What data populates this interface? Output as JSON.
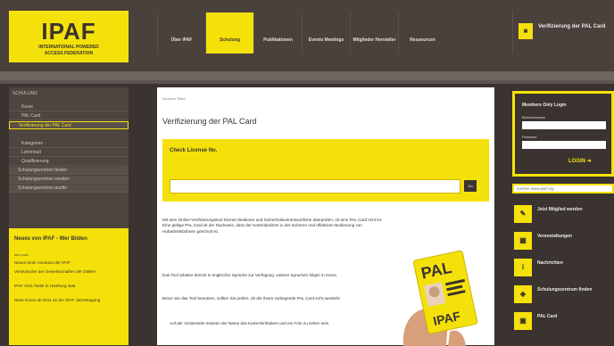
{
  "logo": {
    "name": "IPAF",
    "subtitle_1": "INTERNATIONAL POWERED",
    "subtitle_2": "ACCESS FEDERATION"
  },
  "nav": {
    "items": [
      {
        "label": "Über IPAF"
      },
      {
        "label": "Schulung"
      },
      {
        "label": "Publikationen"
      },
      {
        "label": "Events Meetings"
      },
      {
        "label": "Mitglieder Hersteller"
      },
      {
        "label": "Ressourcen"
      }
    ]
  },
  "verify": {
    "label": "Verifizierung der PAL Card",
    "icon": "pal-card-icon"
  },
  "sidebar": {
    "heading": "SCHULUNG",
    "items": [
      {
        "label": "Kurse"
      },
      {
        "label": "PAL Card"
      },
      {
        "label": "Verifizierung der PAL Card"
      },
      {
        "label": "Kategorien"
      },
      {
        "label": "Lehrinhalt"
      },
      {
        "label": "Qualifizierung"
      },
      {
        "label": "Schulungszentren finden"
      },
      {
        "label": "Schulungszentren werden"
      },
      {
        "label": "Schulungszentren audits"
      }
    ]
  },
  "news": {
    "title": "Neues von IPAF - Wer Bilden",
    "small": "IPAF CARD",
    "paragraphs": [
      "Neues beim Vorstand der IPAF",
      "Vorsitzender der Gewerkschaften der GMBH",
      "IPAF 2011 findet in Hamburg statt",
      "Neue Kurse ab 2011 an der IPAF Jahrestagung"
    ]
  },
  "main": {
    "breadcrumb": "Drucken  Teilen",
    "title": "Verifizierung der PAL Card",
    "check_title": "Check License No.",
    "license_placeholder": "",
    "go_label": "Go",
    "paragraphs": [
      "Mit dem Online-Verifizierungstool können Bediener und Sicherheitsverantwortliche überprüfen, ob eine PAL Card echt ist. Eine gültige PAL Card ist der Nachweis, dass der Kartenbesitzer in der sicheren und effektiven Bedienung von Hubarbeitsbühnen geschult ist.",
      "Das Tool arbeitet derzeit in englischer Sprache zur Verfügung, weitere Sprachen folgen in Kürze.",
      "Bevor Sie das Tool benutzen, sollten Sie prüfen, ob die Ihnen vorliegende PAL Card echt aussieht:",
      "Auf der Vorderseite müssen der Name des Kartenhinhabers und ein Foto zu sehen sein."
    ]
  },
  "login": {
    "title": "Members Only Login",
    "user_label": "Benutzername",
    "pass_label": "Passwort",
    "button": "LOGIN"
  },
  "search": {
    "placeholder": "suchen www.ipaf.org"
  },
  "right_items": [
    {
      "label": "Jetzt Mitglied werden",
      "icon": "pen-icon"
    },
    {
      "label": "Veranstaltungen",
      "icon": "calendar-icon"
    },
    {
      "label": "Nachrichten",
      "icon": "info-icon"
    },
    {
      "label": "Schulungszentrum finden",
      "icon": "map-icon"
    },
    {
      "label": "PAL Card",
      "icon": "pal-icon"
    }
  ],
  "colors": {
    "accent": "#f5e10a",
    "dark": "#3a3330"
  }
}
